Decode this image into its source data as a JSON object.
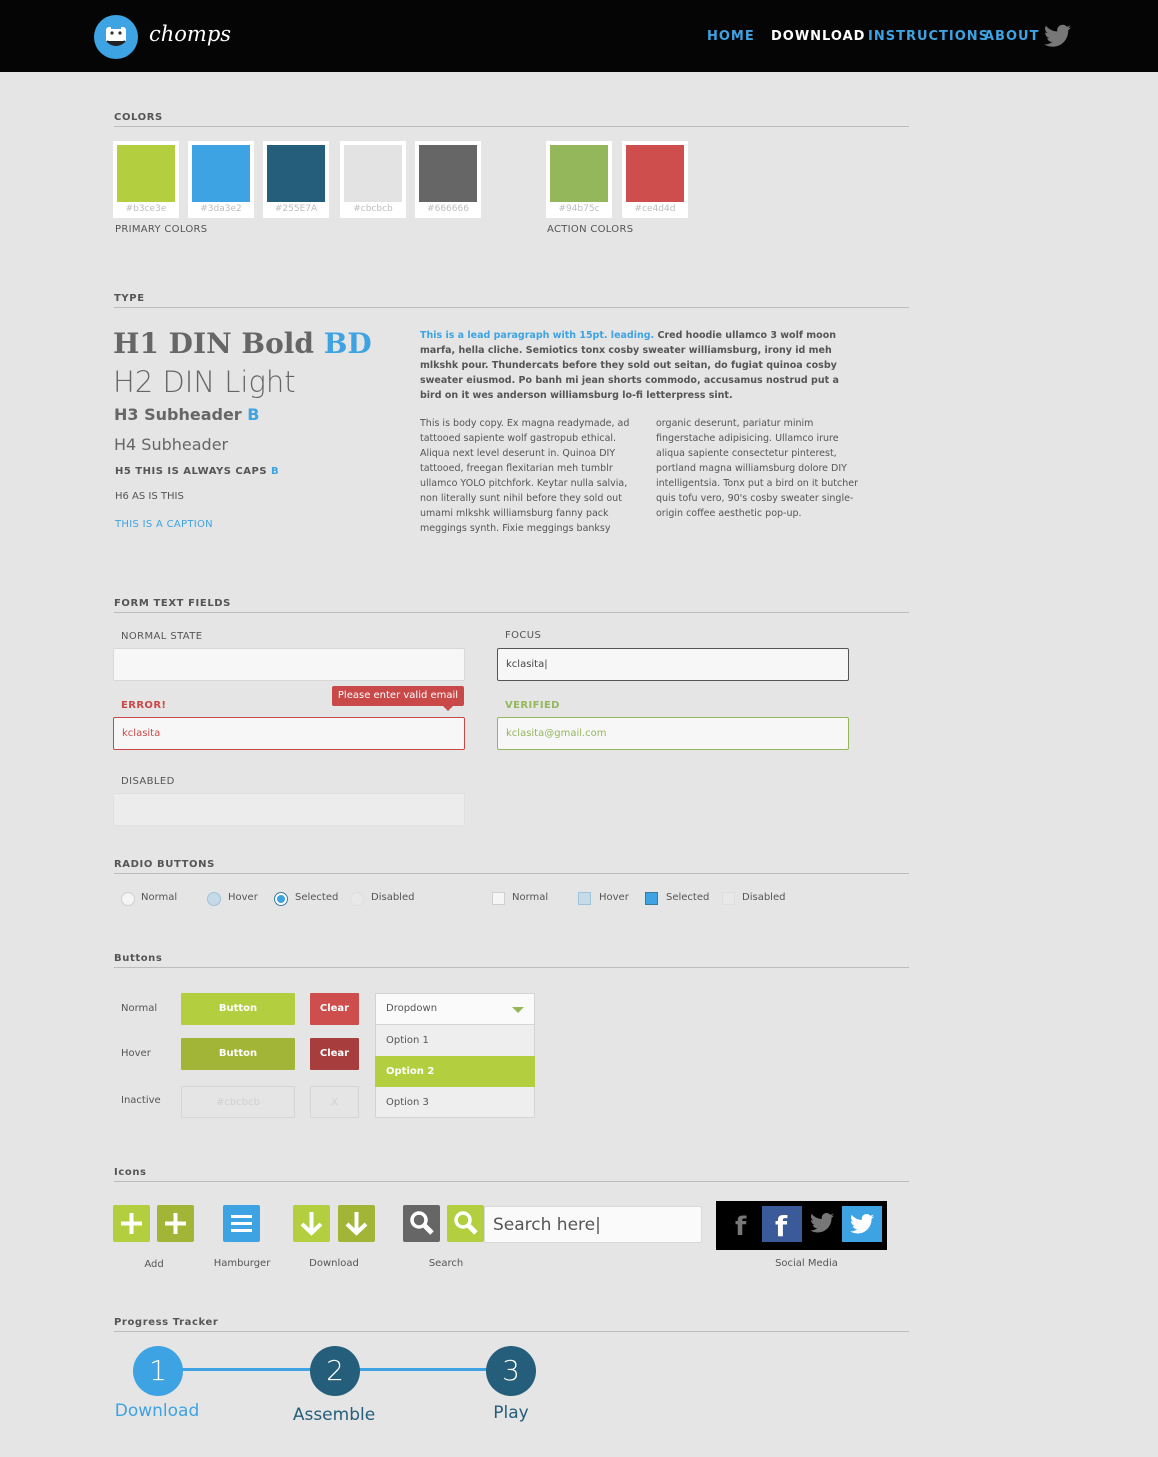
{
  "nav": {
    "brand": "chomps",
    "links": [
      "HOME",
      "DOWNLOAD",
      "INSTRUCTIONS",
      "ABOUT"
    ],
    "active": "DOWNLOAD"
  },
  "colors": {
    "title": "COLORS",
    "primary_label": "PRIMARY COLORS",
    "action_label": "ACTION COLORS",
    "primary": [
      "#b3ce3e",
      "#3da3e2",
      "#255E7A",
      "#cbcbcb",
      "#666666"
    ],
    "action": [
      "#94b75c",
      "#ce4d4d"
    ]
  },
  "type": {
    "title": "TYPE",
    "h1_text": "H1 DIN Bold",
    "h1_accent": "BD",
    "h2": "H2 DIN Light",
    "h3_text": "H3 Subheader",
    "h3_accent": "B",
    "h4": "H4 Subheader",
    "h5_text": "H5 THIS IS ALWAYS CAPS",
    "h5_accent": "B",
    "h6": "H6 AS IS THIS",
    "caption": "THIS IS A CAPTION",
    "lead_accent": "This is a lead paragraph with 15pt. leading.",
    "lead_body": "Cred hoodie ullamco 3 wolf moon marfa, hella cliche. Semiotics tonx cosby sweater williamsburg, irony id meh mlkshk pour. Thundercats before they sold out seitan, do fugiat quinoa cosby sweater eiusmod. Po banh mi jean shorts commodo, accusamus nostrud put a bird on it wes anderson williamsburg lo-fi letterpress sint.",
    "body_col1": "This is body copy. Ex magna readymade, ad tattooed sapiente wolf gastropub ethical. Aliqua next level deserunt in. Quinoa DIY tattooed, freegan flexitarian meh tumblr ullamco YOLO pitchfork. Keytar nulla salvia, non literally sunt nihil before they sold out umami mlkshk williamsburg fanny pack meggings synth. Fixie meggings banksy",
    "body_col2": "organic deserunt, pariatur minim fingerstache adipisicing. Ullamco irure aliqua sapiente consectetur pinterest, portland magna williamsburg dolore DIY intelligentsia. Tonx put a bird on it butcher quis tofu vero, 90's cosby sweater single-origin coffee aesthetic pop-up."
  },
  "form": {
    "title": "FORM TEXT FIELDS",
    "normal_label": "NORMAL STATE",
    "focus_label": "FOCUS",
    "focus_value": "kclasita|",
    "error_label": "ERROR!",
    "error_value": "kclasita",
    "error_tip": "Please enter valid email",
    "verified_label": "VERIFIED",
    "verified_value": "kclasita@gmail.com",
    "disabled_label": "DISABLED"
  },
  "radios": {
    "title": "RADIO BUTTONS",
    "labels": [
      "Normal",
      "Hover",
      "Selected",
      "Disabled"
    ]
  },
  "buttons": {
    "title": "Buttons",
    "row_normal": "Normal",
    "row_hover": "Hover",
    "row_inactive": "Inactive",
    "button_label": "Button",
    "clear_label": "Clear",
    "inactive_button": "#cbcbcb",
    "inactive_clear": "X",
    "dropdown_label": "Dropdown",
    "options": [
      "Option 1",
      "Option 2",
      "Option 3"
    ],
    "selected_option": "Option 2"
  },
  "icons": {
    "title": "Icons",
    "add": "Add",
    "hamburger": "Hamburger",
    "download": "Download",
    "search": "Search",
    "search_placeholder": "Search here|",
    "social": "Social Media"
  },
  "progress": {
    "title": "Progress Tracker",
    "steps": [
      {
        "num": "1",
        "label": "Download"
      },
      {
        "num": "2",
        "label": "Assemble"
      },
      {
        "num": "3",
        "label": "Play"
      }
    ]
  }
}
